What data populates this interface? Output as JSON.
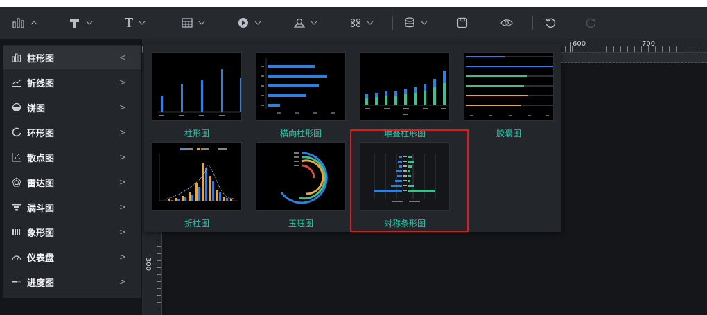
{
  "toolbar": {
    "items": [
      {
        "icon": "bar-chart-icon",
        "has_dropdown": true
      },
      {
        "icon": "paint-brush-icon",
        "has_dropdown": true
      },
      {
        "icon": "text-icon",
        "label": "T",
        "has_dropdown": true
      },
      {
        "icon": "table-icon",
        "has_dropdown": true
      },
      {
        "icon": "media-play-icon",
        "has_dropdown": true
      },
      {
        "icon": "map-pin-icon",
        "has_dropdown": true
      },
      {
        "icon": "grid-icon",
        "has_dropdown": true
      },
      {
        "icon": "database-icon",
        "has_dropdown": true
      },
      {
        "icon": "save-icon",
        "has_dropdown": false
      },
      {
        "icon": "eye-icon",
        "has_dropdown": false
      },
      {
        "icon": "undo-icon",
        "has_dropdown": false
      },
      {
        "icon": "redo-icon",
        "has_dropdown": false
      }
    ]
  },
  "ruler": {
    "h_labels": [
      "600",
      "700"
    ],
    "v_labels": [
      "300"
    ]
  },
  "sidebar": {
    "items": [
      {
        "label": "柱形图",
        "icon": "bar-chart-icon",
        "chevron": "<",
        "active": true
      },
      {
        "label": "折线图",
        "icon": "line-chart-icon",
        "chevron": ">"
      },
      {
        "label": "饼图",
        "icon": "pie-chart-icon",
        "chevron": ">"
      },
      {
        "label": "环形图",
        "icon": "ring-chart-icon",
        "chevron": ">"
      },
      {
        "label": "散点图",
        "icon": "scatter-chart-icon",
        "chevron": ">"
      },
      {
        "label": "雷达图",
        "icon": "radar-chart-icon",
        "chevron": ">"
      },
      {
        "label": "漏斗图",
        "icon": "funnel-chart-icon",
        "chevron": ">"
      },
      {
        "label": "象形图",
        "icon": "pictorial-chart-icon",
        "chevron": ">"
      },
      {
        "label": "仪表盘",
        "icon": "gauge-icon",
        "chevron": ">"
      },
      {
        "label": "进度图",
        "icon": "progress-icon",
        "chevron": ">"
      }
    ]
  },
  "popover": {
    "cards": [
      {
        "label": "柱形图",
        "thumb": "bar"
      },
      {
        "label": "横向柱形图",
        "thumb": "hbar"
      },
      {
        "label": "堆叠柱形图",
        "thumb": "stacked"
      },
      {
        "label": "胶囊图",
        "thumb": "capsule"
      },
      {
        "label": "折柱图",
        "thumb": "linebar"
      },
      {
        "label": "玉珏图",
        "thumb": "jade"
      },
      {
        "label": "对称条形图",
        "thumb": "symmetric",
        "highlighted": true
      }
    ]
  },
  "colors": {
    "accent_label": "#20c9a8",
    "highlight_border": "#e01b1b",
    "bar_blue": "#2f7fdc",
    "bar_green": "#3fbf8a",
    "bar_orange": "#e8a640"
  }
}
